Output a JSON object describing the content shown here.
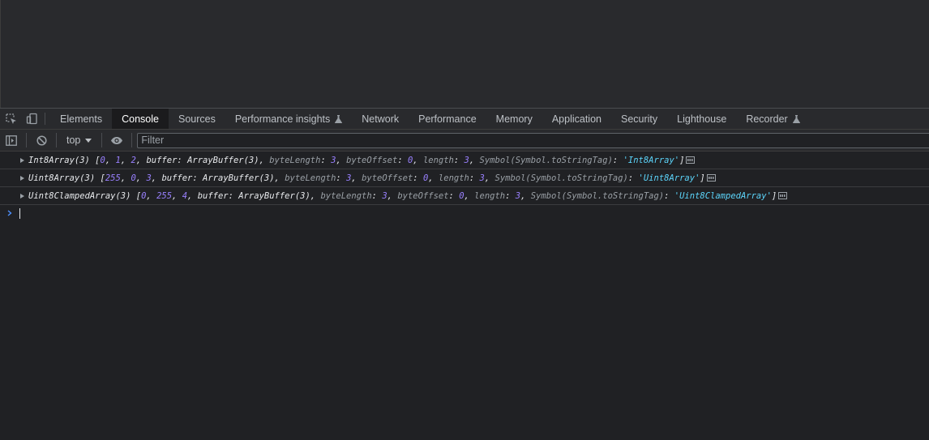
{
  "devtools": {
    "tabs": [
      {
        "label": "Elements",
        "active": false,
        "experimental": false
      },
      {
        "label": "Console",
        "active": true,
        "experimental": false
      },
      {
        "label": "Sources",
        "active": false,
        "experimental": false
      },
      {
        "label": "Performance insights",
        "active": false,
        "experimental": true
      },
      {
        "label": "Network",
        "active": false,
        "experimental": false
      },
      {
        "label": "Performance",
        "active": false,
        "experimental": false
      },
      {
        "label": "Memory",
        "active": false,
        "experimental": false
      },
      {
        "label": "Application",
        "active": false,
        "experimental": false
      },
      {
        "label": "Security",
        "active": false,
        "experimental": false
      },
      {
        "label": "Lighthouse",
        "active": false,
        "experimental": false
      },
      {
        "label": "Recorder",
        "active": false,
        "experimental": true
      }
    ],
    "icons": [
      "inspect-element-icon",
      "device-toolbar-icon",
      "sidebar-toggle-icon",
      "clear-console-icon",
      "live-expression-eye-icon",
      "flask-icon",
      "info-icon"
    ]
  },
  "console_toolbar": {
    "context": "top",
    "filter_placeholder": "Filter"
  },
  "console": {
    "messages": [
      {
        "type_label": "Int8Array(3)",
        "values": [
          "0",
          "1",
          "2"
        ],
        "buffer": "ArrayBuffer(3)",
        "byteLength": "3",
        "byteOffset": "0",
        "length": "3",
        "symbol_key": "Symbol(Symbol.toStringTag)",
        "symbol_value": "'Int8Array'"
      },
      {
        "type_label": "Uint8Array(3)",
        "values": [
          "255",
          "0",
          "3"
        ],
        "buffer": "ArrayBuffer(3)",
        "byteLength": "3",
        "byteOffset": "0",
        "length": "3",
        "symbol_key": "Symbol(Symbol.toStringTag)",
        "symbol_value": "'Uint8Array'"
      },
      {
        "type_label": "Uint8ClampedArray(3)",
        "values": [
          "0",
          "255",
          "4"
        ],
        "buffer": "ArrayBuffer(3)",
        "byteLength": "3",
        "byteOffset": "0",
        "length": "3",
        "symbol_key": "Symbol(Symbol.toStringTag)",
        "symbol_value": "'Uint8ClampedArray'"
      }
    ],
    "keys": {
      "buffer": "buffer",
      "byteLength": "byteLength",
      "byteOffset": "byteOffset",
      "length": "length"
    }
  },
  "colors": {
    "panel_bg": "#202124",
    "toolbar_bg": "#292a2d",
    "number": "#9980ff",
    "string": "#5cd5fb",
    "prompt": "#4d90fe"
  }
}
